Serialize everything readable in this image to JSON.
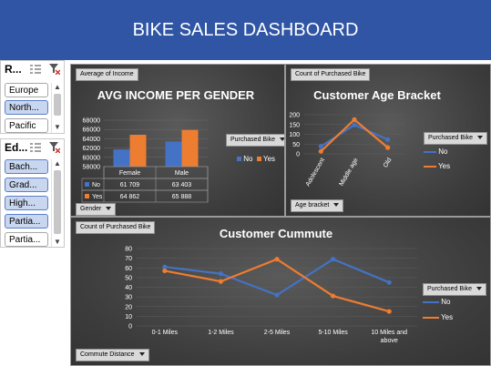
{
  "header": {
    "title": "BIKE SALES DASHBOARD"
  },
  "slicer_region": {
    "title": "R...",
    "items": [
      {
        "label": "Europe",
        "selected": false
      },
      {
        "label": "North...",
        "selected": true
      },
      {
        "label": "Pacific",
        "selected": false
      }
    ]
  },
  "slicer_education": {
    "title": "Ed...",
    "items": [
      {
        "label": "Bach...",
        "selected": true
      },
      {
        "label": "Grad...",
        "selected": true
      },
      {
        "label": "High...",
        "selected": true
      },
      {
        "label": "Partia...",
        "selected": true
      },
      {
        "label": "Partia...",
        "selected": false
      }
    ]
  },
  "colors": {
    "no": "#4472c4",
    "yes": "#ed7d31",
    "header": "#2f55a4"
  },
  "income_chart": {
    "field_tag": "Average of Income",
    "axis_tag": "Gender",
    "legend_tag": "Purchased Bike",
    "chart_data": {
      "type": "bar",
      "title": "AVG INCOME PER GENDER",
      "categories": [
        "Female",
        "Male"
      ],
      "series": [
        {
          "name": "No",
          "values": [
            61709,
            63403
          ]
        },
        {
          "name": "Yes",
          "values": [
            64862,
            65888
          ]
        }
      ],
      "ylim": [
        58000,
        68000
      ],
      "yticks": [
        "68000",
        "66000",
        "64000",
        "62000",
        "60000",
        "58000"
      ],
      "table": {
        "headers": [
          "Female",
          "Male"
        ],
        "rows": [
          {
            "label": "No",
            "values": [
              "61 709",
              "63 403"
            ]
          },
          {
            "label": "Yes",
            "values": [
              "64 862",
              "65 888"
            ]
          }
        ]
      }
    }
  },
  "age_chart": {
    "field_tag": "Count of Purchased Bike",
    "axis_tag": "Age bracket",
    "legend_tag": "Purchased Bike",
    "chart_data": {
      "type": "line",
      "title": "Customer Age Bracket",
      "categories": [
        "Adolescent",
        "Middle age",
        "Old"
      ],
      "series": [
        {
          "name": "No",
          "values": [
            38,
            148,
            73
          ]
        },
        {
          "name": "Yes",
          "values": [
            13,
            175,
            32
          ]
        }
      ],
      "ylim": [
        0,
        200
      ],
      "yticks": [
        "200",
        "150",
        "100",
        "50",
        "0"
      ]
    }
  },
  "commute_chart": {
    "field_tag": "Count of Purchased Bike",
    "axis_tag": "Commute Distance",
    "legend_tag": "Purchased Bike",
    "chart_data": {
      "type": "line",
      "title": "Customer Cummute",
      "categories": [
        "0-1 Miles",
        "1-2 Miles",
        "2-5 Miles",
        "5-10 Miles",
        "10 Miles and above"
      ],
      "series": [
        {
          "name": "No",
          "values": [
            61,
            54,
            32,
            69,
            45
          ]
        },
        {
          "name": "Yes",
          "values": [
            57,
            46,
            69,
            31,
            15
          ]
        }
      ],
      "ylim": [
        0,
        80
      ],
      "yticks": [
        "80",
        "70",
        "60",
        "50",
        "40",
        "30",
        "20",
        "10",
        "0"
      ]
    }
  }
}
